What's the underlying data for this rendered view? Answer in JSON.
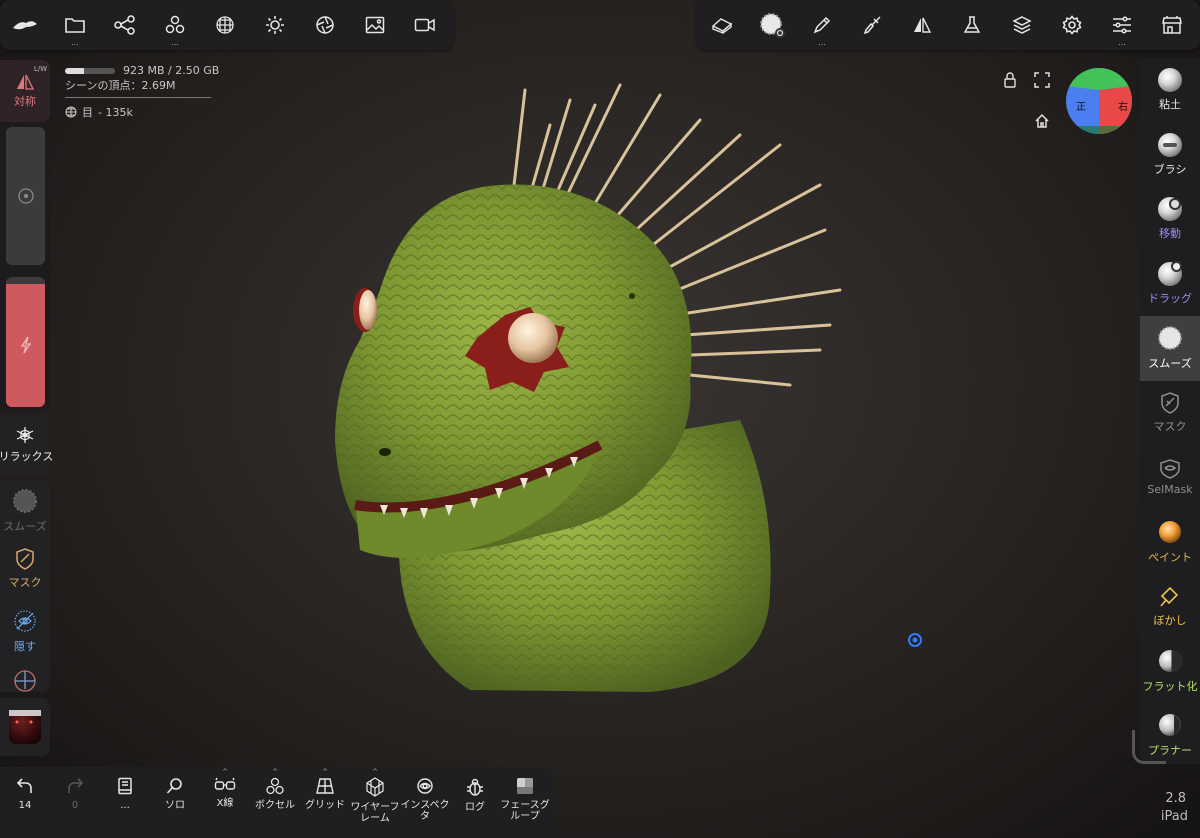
{
  "top_left_toolbar": [
    {
      "id": "logo",
      "icon": "nomad-logo-icon"
    },
    {
      "id": "files",
      "icon": "folder-icon",
      "dots": "..."
    },
    {
      "id": "scene",
      "icon": "scene-graph-icon"
    },
    {
      "id": "add",
      "icon": "add-shapes-icon",
      "dots": "..."
    },
    {
      "id": "topology",
      "icon": "topology-sphere-icon"
    },
    {
      "id": "lighting",
      "icon": "sun-icon"
    },
    {
      "id": "postprocess",
      "icon": "aperture-icon"
    },
    {
      "id": "background",
      "icon": "image-icon"
    },
    {
      "id": "video",
      "icon": "video-camera-icon"
    }
  ],
  "top_right_toolbar": [
    {
      "id": "eraser",
      "icon": "eraser-icon"
    },
    {
      "id": "tool",
      "icon": "smooth-brush-icon"
    },
    {
      "id": "stroke",
      "icon": "pen-icon",
      "dots": "..."
    },
    {
      "id": "painting",
      "icon": "paint-brush-icon"
    },
    {
      "id": "symmetry",
      "icon": "symmetry-icon"
    },
    {
      "id": "material",
      "icon": "flask-icon"
    },
    {
      "id": "layers",
      "icon": "layers-icon"
    },
    {
      "id": "settings",
      "icon": "gear-icon"
    },
    {
      "id": "interface",
      "icon": "sliders-icon"
    },
    {
      "id": "shop",
      "icon": "shop-icon"
    }
  ],
  "stats": {
    "memory": "923 MB / 2.50 GB",
    "memory_fraction": 0.37,
    "scene_vertices": "シーンの頂点：2.69M",
    "object_name": "目",
    "object_vertices": "- 135k"
  },
  "left_panel": {
    "symmetry_label": "対称",
    "symmetry_badge": "L/W",
    "intensity_fraction": 0.95,
    "relax_label": "リラックス",
    "tools": [
      {
        "label": "スムーズ",
        "color": "#6a6a6a",
        "icon": "smooth-icon"
      },
      {
        "label": "マスク",
        "color": "#d9a86c",
        "icon": "mask-shield-icon"
      },
      {
        "label": "隠す",
        "color": "#6fa9ee",
        "icon": "hide-icon"
      }
    ]
  },
  "right_panel": [
    {
      "label": "粘土",
      "color": "#eaeaea",
      "icon": "clay-brush-icon",
      "active": false
    },
    {
      "label": "ブラシ",
      "color": "#eaeaea",
      "icon": "brush-icon",
      "active": false
    },
    {
      "label": "移動",
      "color": "#9b8df2",
      "icon": "move-icon",
      "active": false
    },
    {
      "label": "ドラッグ",
      "color": "#9b8df2",
      "icon": "drag-icon",
      "active": false
    },
    {
      "label": "スムーズ",
      "color": "#ffffff",
      "icon": "smooth-icon",
      "active": true
    },
    {
      "label": "マスク",
      "color": "#8f8f8f",
      "icon": "mask-icon",
      "active": false
    },
    {
      "label": "SelMask",
      "color": "#8f8f8f",
      "icon": "select-mask-icon",
      "active": false
    },
    {
      "label": "ペイント",
      "color": "#f0b64c",
      "icon": "paint-icon",
      "active": false
    },
    {
      "label": "ぼかし",
      "color": "#f0c04c",
      "icon": "blur-icon",
      "active": false
    },
    {
      "label": "フラット化",
      "color": "#b7e067",
      "icon": "flatten-icon",
      "active": false
    },
    {
      "label": "プラナー",
      "color": "#b7e067",
      "icon": "planar-icon",
      "active": false
    }
  ],
  "nav_cube": {
    "front": "正",
    "right": "右"
  },
  "bottom_toolbar": [
    {
      "label": "14",
      "icon": "undo-icon",
      "caret": false
    },
    {
      "label": "0",
      "icon": "redo-icon",
      "caret": false
    },
    {
      "label": "...",
      "icon": "book-icon",
      "caret": false
    },
    {
      "label": "ソロ",
      "icon": "search-icon",
      "caret": false
    },
    {
      "label": "X線",
      "icon": "glasses-icon",
      "caret": true
    },
    {
      "label": "ボクセル",
      "icon": "voxel-icon",
      "caret": true
    },
    {
      "label": "グリッド",
      "icon": "grid-icon",
      "caret": true
    },
    {
      "label": "ワイヤーフレーム",
      "icon": "wireframe-icon",
      "caret": true
    },
    {
      "label": "インスペクタ",
      "icon": "inspector-icon",
      "caret": false
    },
    {
      "label": "ログ",
      "icon": "bug-icon",
      "caret": false
    },
    {
      "label": "フェースグループ",
      "icon": "facegroup-icon",
      "caret": false
    }
  ],
  "version": {
    "number": "2.8",
    "device": "iPad"
  }
}
